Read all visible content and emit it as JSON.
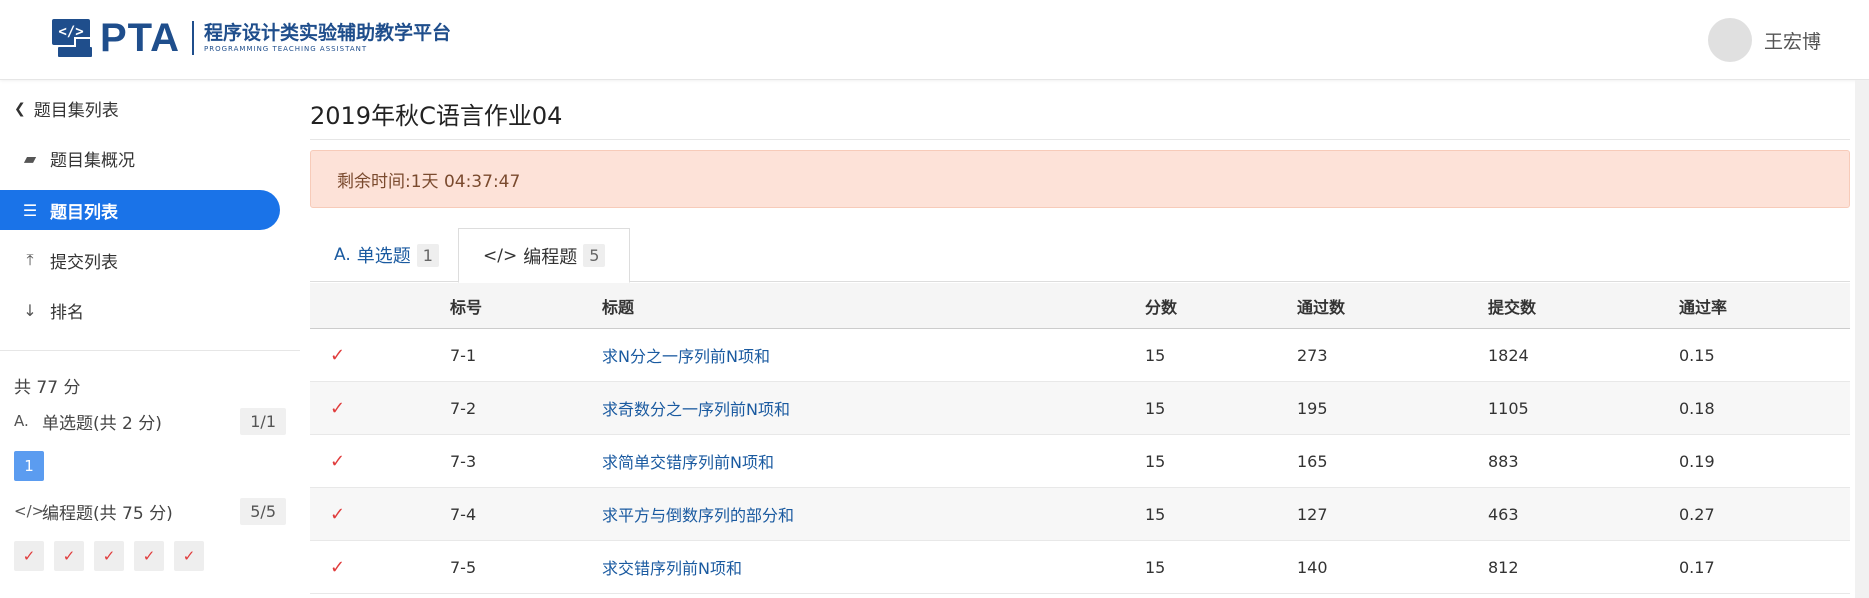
{
  "header": {
    "logo_text": "PTA",
    "logo_icon_text": "</>",
    "subtitle_cn": "程序设计类实验辅助教学平台",
    "subtitle_en": "PROGRAMMING TEACHING ASSISTANT",
    "username": "王宏博"
  },
  "sidebar": {
    "back_label": "题目集列表",
    "nav": [
      {
        "label": "题目集概况",
        "icon": "book-icon",
        "glyph": "▰"
      },
      {
        "label": "题目列表",
        "icon": "list-icon",
        "glyph": "☰",
        "active": true
      },
      {
        "label": "提交列表",
        "icon": "upload-icon",
        "glyph": "⤒"
      },
      {
        "label": "排名",
        "icon": "sort-numeric-icon",
        "glyph": "↓"
      }
    ],
    "total": "共 77 分",
    "sections": [
      {
        "icon_glyph": "A.",
        "label": "单选题(共 2 分)",
        "progress": "1/1",
        "boxes": [
          "1"
        ]
      },
      {
        "icon_glyph": "</>",
        "label": "编程题(共 75 分)",
        "progress": "5/5",
        "boxes": [
          "✓",
          "✓",
          "✓",
          "✓",
          "✓"
        ]
      }
    ]
  },
  "main": {
    "title": "2019年秋C语言作业04",
    "alert": "剩余时间:1天 04:37:47",
    "tabs": [
      {
        "icon_glyph": "A.",
        "label": "单选题",
        "count": "1",
        "active": false
      },
      {
        "icon_glyph": "</>",
        "label": "编程题",
        "count": "5",
        "active": true
      }
    ],
    "table": {
      "headers": {
        "num": "标号",
        "title": "标题",
        "score": "分数",
        "pass": "通过数",
        "submit": "提交数",
        "rate": "通过率"
      },
      "rows": [
        {
          "check": "✓",
          "num": "7-1",
          "title": "求N分之一序列前N项和",
          "score": "15",
          "pass": "273",
          "submit": "1824",
          "rate": "0.15"
        },
        {
          "check": "✓",
          "num": "7-2",
          "title": "求奇数分之一序列前N项和",
          "score": "15",
          "pass": "195",
          "submit": "1105",
          "rate": "0.18"
        },
        {
          "check": "✓",
          "num": "7-3",
          "title": "求简单交错序列前N项和",
          "score": "15",
          "pass": "165",
          "submit": "883",
          "rate": "0.19"
        },
        {
          "check": "✓",
          "num": "7-4",
          "title": "求平方与倒数序列的部分和",
          "score": "15",
          "pass": "127",
          "submit": "463",
          "rate": "0.27"
        },
        {
          "check": "✓",
          "num": "7-5",
          "title": "求交错序列前N项和",
          "score": "15",
          "pass": "140",
          "submit": "812",
          "rate": "0.17"
        }
      ]
    }
  }
}
